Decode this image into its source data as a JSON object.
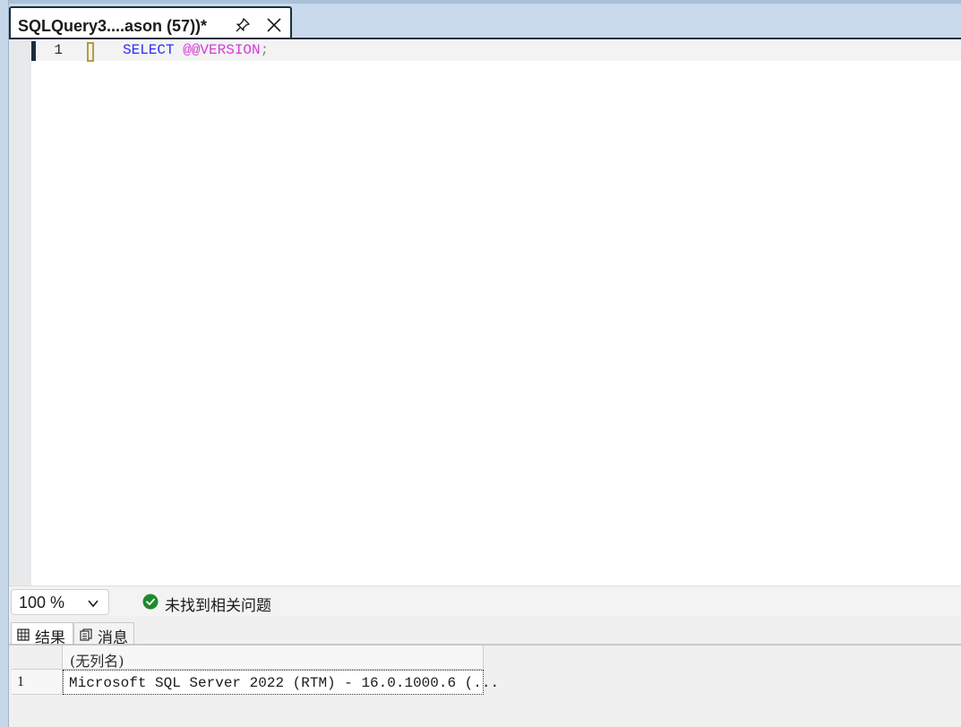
{
  "document_tab": {
    "title": "SQLQuery3....ason (57))*",
    "pin_icon": "pin-icon",
    "close_icon": "close-icon"
  },
  "editor": {
    "lines": [
      {
        "number": "1",
        "keyword": "SELECT",
        "system_variable": "@@VERSION",
        "terminator": ";"
      }
    ],
    "colors": {
      "keyword": "#2d2dff",
      "system_variable": "#d63bd6",
      "punctuation": "#888888"
    }
  },
  "statusbar": {
    "zoom": "100 %",
    "zoom_icon": "chevron-down-icon",
    "status_icon": "success-check-icon",
    "status_text": "未找到相关问题",
    "status_color": "#1e8a2e"
  },
  "results_pane": {
    "tabs": [
      {
        "label": "结果",
        "icon": "grid-icon",
        "active": true
      },
      {
        "label": "消息",
        "icon": "messages-icon",
        "active": false
      }
    ],
    "grid": {
      "columns": [
        "(无列名)"
      ],
      "rows": [
        {
          "row_number": "1",
          "cells": [
            "Microsoft SQL Server 2022 (RTM) - 16.0.1000.6 (..."
          ]
        }
      ]
    }
  }
}
